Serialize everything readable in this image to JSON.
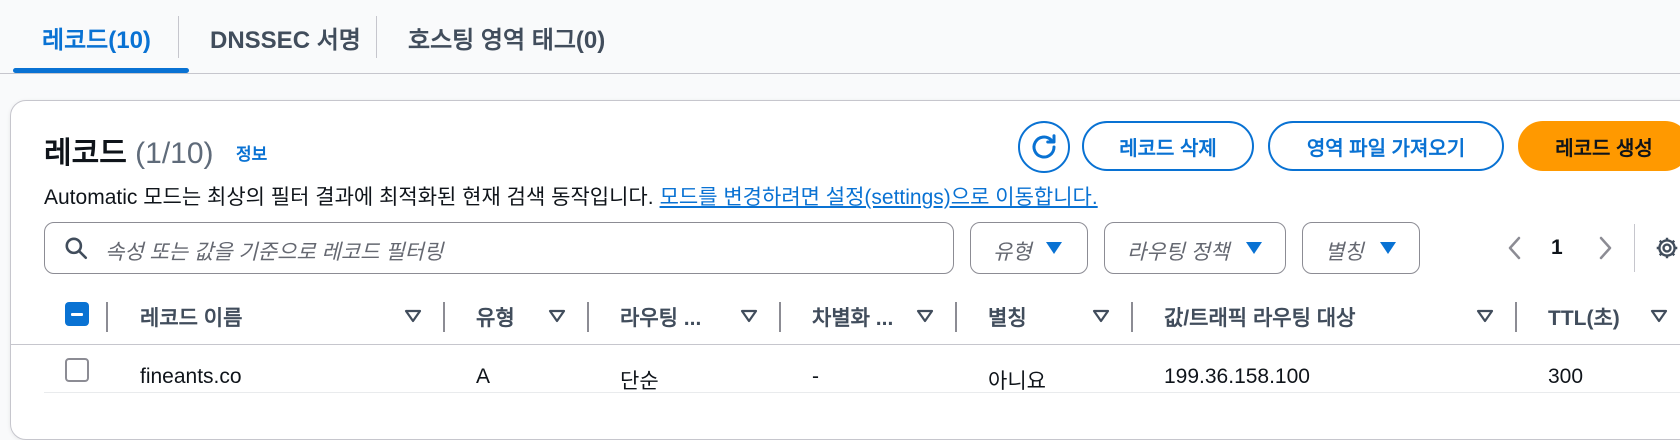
{
  "tabs": [
    {
      "label": "레코드(10)",
      "active": true
    },
    {
      "label": "DNSSEC 서명",
      "active": false
    },
    {
      "label": "호스팅 영역 태그(0)",
      "active": false
    }
  ],
  "header": {
    "title": "레코드",
    "count": "(1/10)",
    "info_link": "정보",
    "description": "Automatic 모드는 최상의 필터 결과에 최적화된 현재 검색 동작입니다.",
    "description_link": "모드를 변경하려면 설정(settings)으로 이동합니다."
  },
  "actions": {
    "refresh_icon": "refresh-icon",
    "delete_label": "레코드 삭제",
    "import_label": "영역 파일 가져오기",
    "create_label": "레코드 생성"
  },
  "search": {
    "placeholder": "속성 또는 값을 기준으로 레코드 필터링"
  },
  "filters": [
    {
      "label": "유형"
    },
    {
      "label": "라우팅 정책"
    },
    {
      "label": "별칭"
    }
  ],
  "pagination": {
    "current_page": "1"
  },
  "table": {
    "columns": [
      "레코드 이름",
      "유형",
      "라우팅 ...",
      "차별화 ...",
      "별칭",
      "값/트래픽 라우팅 대상",
      "TTL(초)"
    ],
    "rows": [
      {
        "name": "fineants.co",
        "type": "A",
        "routing": "단순",
        "differentiator": "-",
        "alias": "아니요",
        "value": "199.36.158.100",
        "ttl": "300",
        "selected": false
      }
    ]
  },
  "colors": {
    "accent": "#0972d3",
    "primary_button": "#ff9900",
    "text": "#0f141a",
    "muted": "#5f6b7a"
  }
}
